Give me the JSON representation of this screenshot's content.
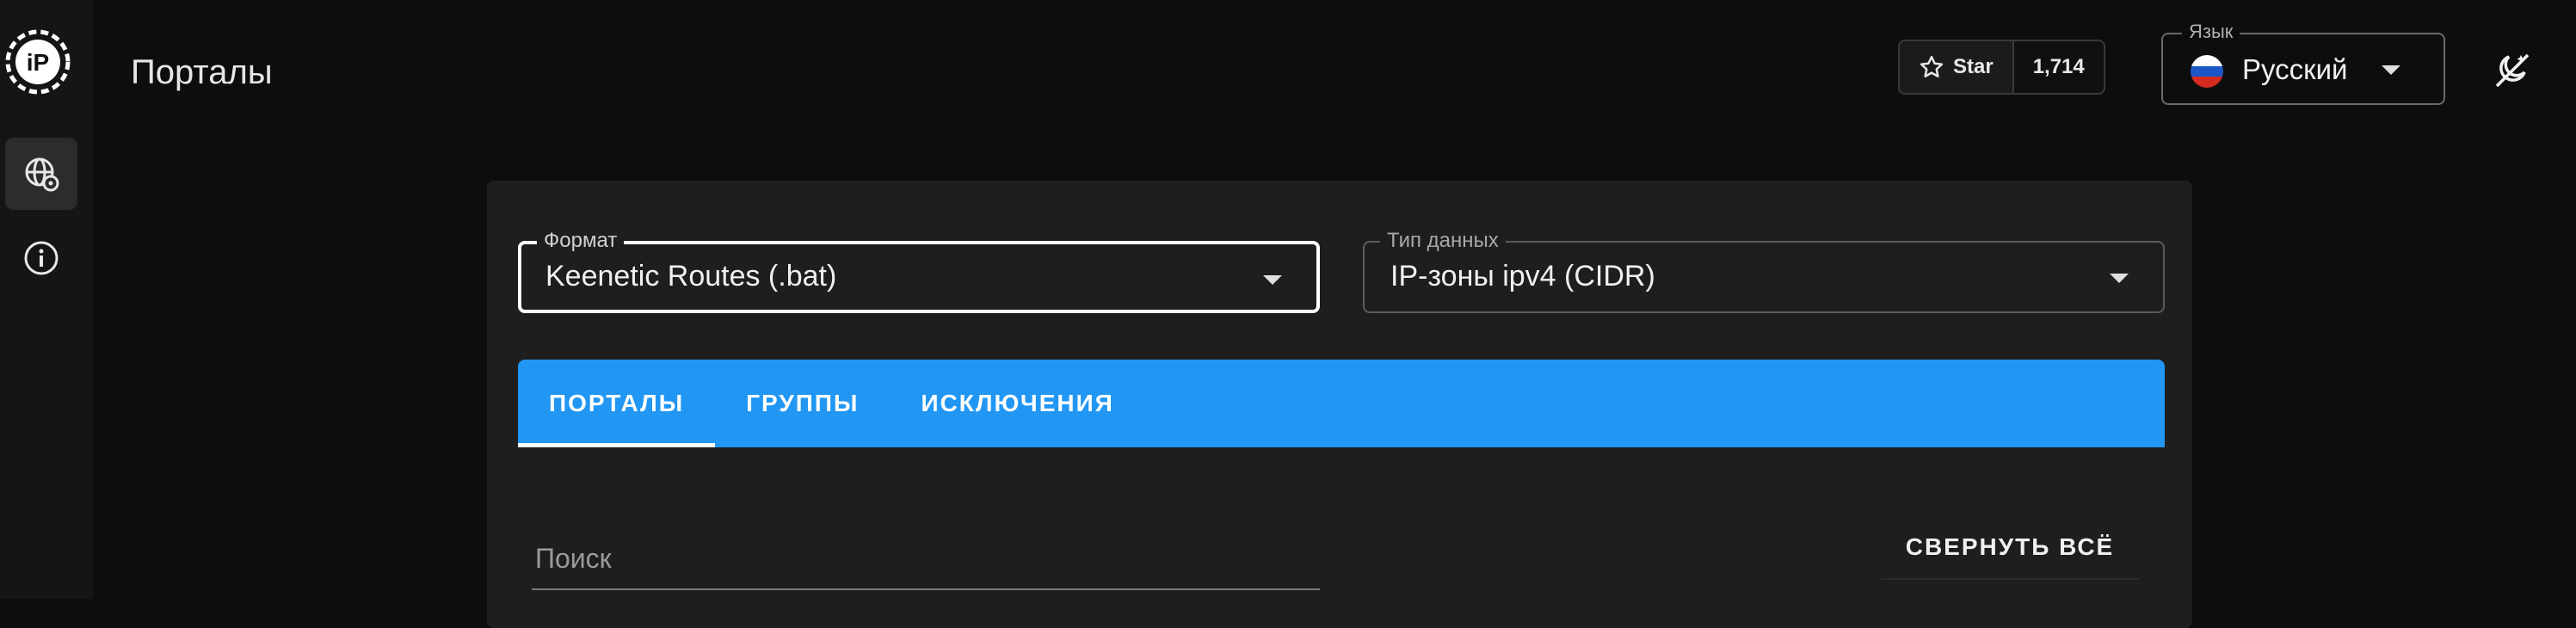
{
  "header": {
    "title": "Порталы",
    "star_label": "Star",
    "star_count": "1,714",
    "language": {
      "legend": "Язык",
      "value": "Русский"
    }
  },
  "sidebar": {
    "items": [
      {
        "icon": "globe-settings-icon",
        "active": true
      },
      {
        "icon": "info-icon",
        "active": false
      }
    ]
  },
  "form": {
    "format": {
      "legend": "Формат",
      "value": "Keenetic Routes (.bat)"
    },
    "data_type": {
      "legend": "Тип данных",
      "value": "IP-зоны ipv4 (CIDR)"
    }
  },
  "tabs": [
    {
      "label": "ПОРТАЛЫ",
      "active": true
    },
    {
      "label": "ГРУППЫ",
      "active": false
    },
    {
      "label": "ИСКЛЮЧЕНИЯ",
      "active": false
    }
  ],
  "search": {
    "placeholder": "Поиск"
  },
  "collapse_all_label": "СВЕРНУТЬ ВСЁ",
  "colors": {
    "accent": "#2196f3",
    "background": "#0d0d0d",
    "card": "#1e1e1e"
  }
}
